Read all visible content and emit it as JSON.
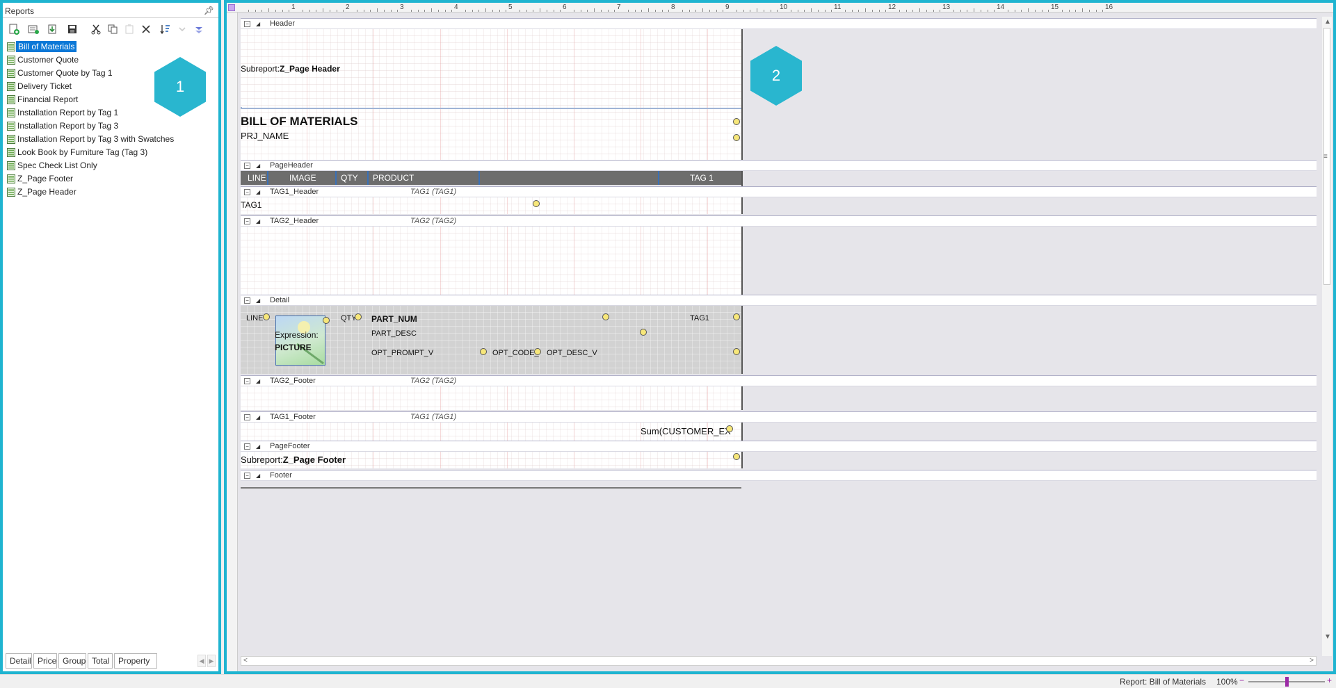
{
  "reports_panel": {
    "title": "Reports",
    "pin_icon": "pin-icon",
    "toolbar": [
      "new-report-icon",
      "add-report-icon",
      "import-icon",
      "save-icon",
      "cut-icon",
      "copy-icon",
      "paste-icon",
      "delete-icon",
      "sort-icon",
      "move-down-icon",
      "collapse-icon"
    ],
    "items": [
      {
        "label": "Bill of Materials",
        "selected": true
      },
      {
        "label": "Customer Quote"
      },
      {
        "label": "Customer Quote by Tag 1"
      },
      {
        "label": "Delivery Ticket"
      },
      {
        "label": "Financial Report"
      },
      {
        "label": "Installation Report by Tag 1"
      },
      {
        "label": "Installation Report by Tag 3"
      },
      {
        "label": "Installation Report by Tag 3 with Swatches"
      },
      {
        "label": "Look Book by Furniture Tag (Tag 3)"
      },
      {
        "label": "Spec Check List Only"
      },
      {
        "label": "Z_Page Footer"
      },
      {
        "label": "Z_Page Header"
      }
    ],
    "callout": "1",
    "tabs": [
      "Detail",
      "Price",
      "Group",
      "Total",
      "Property"
    ]
  },
  "designer": {
    "ruler_labels": [
      "1",
      "2",
      "3",
      "4",
      "5",
      "6",
      "7",
      "8",
      "9",
      "10",
      "11",
      "12",
      "13",
      "14",
      "15",
      "16"
    ],
    "callout": "2",
    "bands": {
      "header": {
        "name": "Header",
        "subreport_prefix": "Subreport:",
        "subreport_name": "Z_Page Header",
        "title": "BILL OF MATERIALS",
        "project_field": "PRJ_NAME"
      },
      "page_header": {
        "name": "PageHeader",
        "columns": [
          "LINE",
          "IMAGE",
          "QTY",
          "PRODUCT",
          "TAG 1"
        ]
      },
      "tag1_header": {
        "name": "TAG1_Header",
        "group": "TAG1 (TAG1)",
        "field": "TAG1"
      },
      "tag2_header": {
        "name": "TAG2_Header",
        "group": "TAG2 (TAG2)"
      },
      "detail": {
        "name": "Detail",
        "fields": {
          "line": "LINE",
          "qty": "QTY",
          "picture_expr": "Expression:",
          "picture_name": "PICTURE",
          "part_num": "PART_NUM",
          "tag1": "TAG1",
          "part_desc": "PART_DESC",
          "opt_prompt": "OPT_PROMPT_V",
          "opt_code": "OPT_CODE_",
          "opt_desc": "OPT_DESC_V"
        }
      },
      "tag2_footer": {
        "name": "TAG2_Footer",
        "group": "TAG2 (TAG2)"
      },
      "tag1_footer": {
        "name": "TAG1_Footer",
        "group": "TAG1 (TAG1)",
        "sum": "Sum(CUSTOMER_EX"
      },
      "page_footer": {
        "name": "PageFooter",
        "subreport_prefix": "Subreport:",
        "subreport_name": "Z_Page Footer"
      },
      "footer": {
        "name": "Footer"
      }
    }
  },
  "status_bar": {
    "report": "Report: Bill of Materials",
    "zoom": "100%",
    "zoom_level_percent": 100
  },
  "colors": {
    "accent": "#1fb4d0",
    "selection": "#0b78d7",
    "page_header_row": "#6d6d6d",
    "zoom_thumb": "#9c2aa6"
  }
}
